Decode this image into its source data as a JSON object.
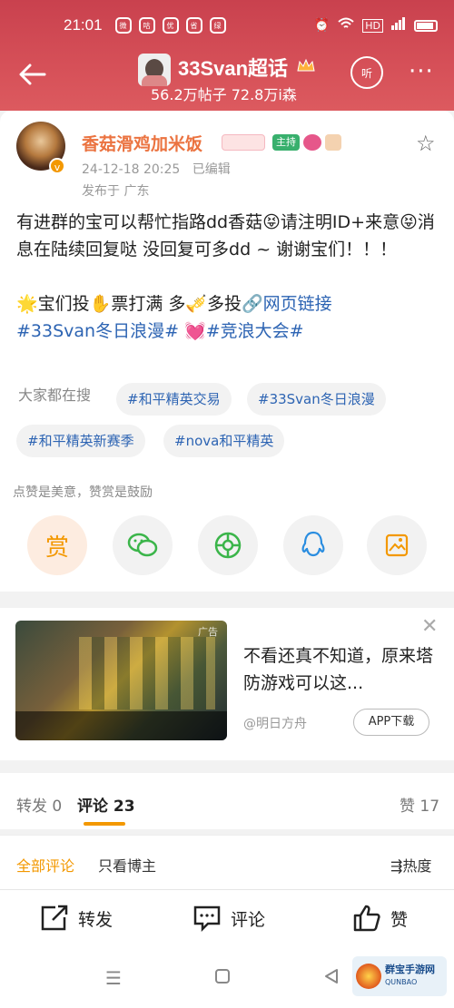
{
  "status": {
    "time": "21:01",
    "apps": [
      "微",
      "咕",
      "优",
      "省",
      "绿"
    ]
  },
  "nav": {
    "title": "33Svan超话",
    "stats": "56.2万帖子 72.8万i森",
    "listen_label": "听"
  },
  "post": {
    "author": "香菇滑鸡加米饭",
    "host_chip": "主持",
    "timestamp": "24-12-18 20:25",
    "edited": "已编辑",
    "location": "发布于 广东",
    "paragraph1": "有进群的宝可以帮忙指路dd香菇😝请注明ID+来意😝消息在陆续回复哒 没回复可多dd ~ 谢谢宝们！！！",
    "paragraph2_prefix": "🌟宝们投✋票打满 多🎺多投",
    "web_link": "🔗网页链接",
    "paragraph3_a": "#33Svan冬日浪漫#",
    "paragraph3_b": " 💓",
    "paragraph3_c": "#竞浪大会#"
  },
  "hot_search": {
    "label": "大家都在搜",
    "tags": [
      "#和平精英交易",
      "#33Svan冬日浪漫",
      "#和平精英新赛季",
      "#nova和平精英"
    ]
  },
  "praise_note": "点赞是美意，赞赏是鼓励",
  "share": {
    "reward_label": "赏"
  },
  "ad": {
    "tag": "广告",
    "text": "不看还真不知道，原来塔防游戏可以这...",
    "source": "@明日方舟",
    "button": "APP下载"
  },
  "tabs": {
    "repost": "转发 0",
    "comment": "评论 23",
    "like": "赞 17"
  },
  "filter": {
    "all": "全部评论",
    "author_only": "只看博主",
    "sort": "热度"
  },
  "actions": {
    "repost": "转发",
    "comment": "评论",
    "like": "赞"
  },
  "watermark": {
    "line1": "群宝手游网",
    "line2": "QUNBAO"
  },
  "colors": {
    "header": "#d14a53",
    "accent": "#f39800",
    "link": "#2d64b3",
    "name": "#eb7340"
  }
}
